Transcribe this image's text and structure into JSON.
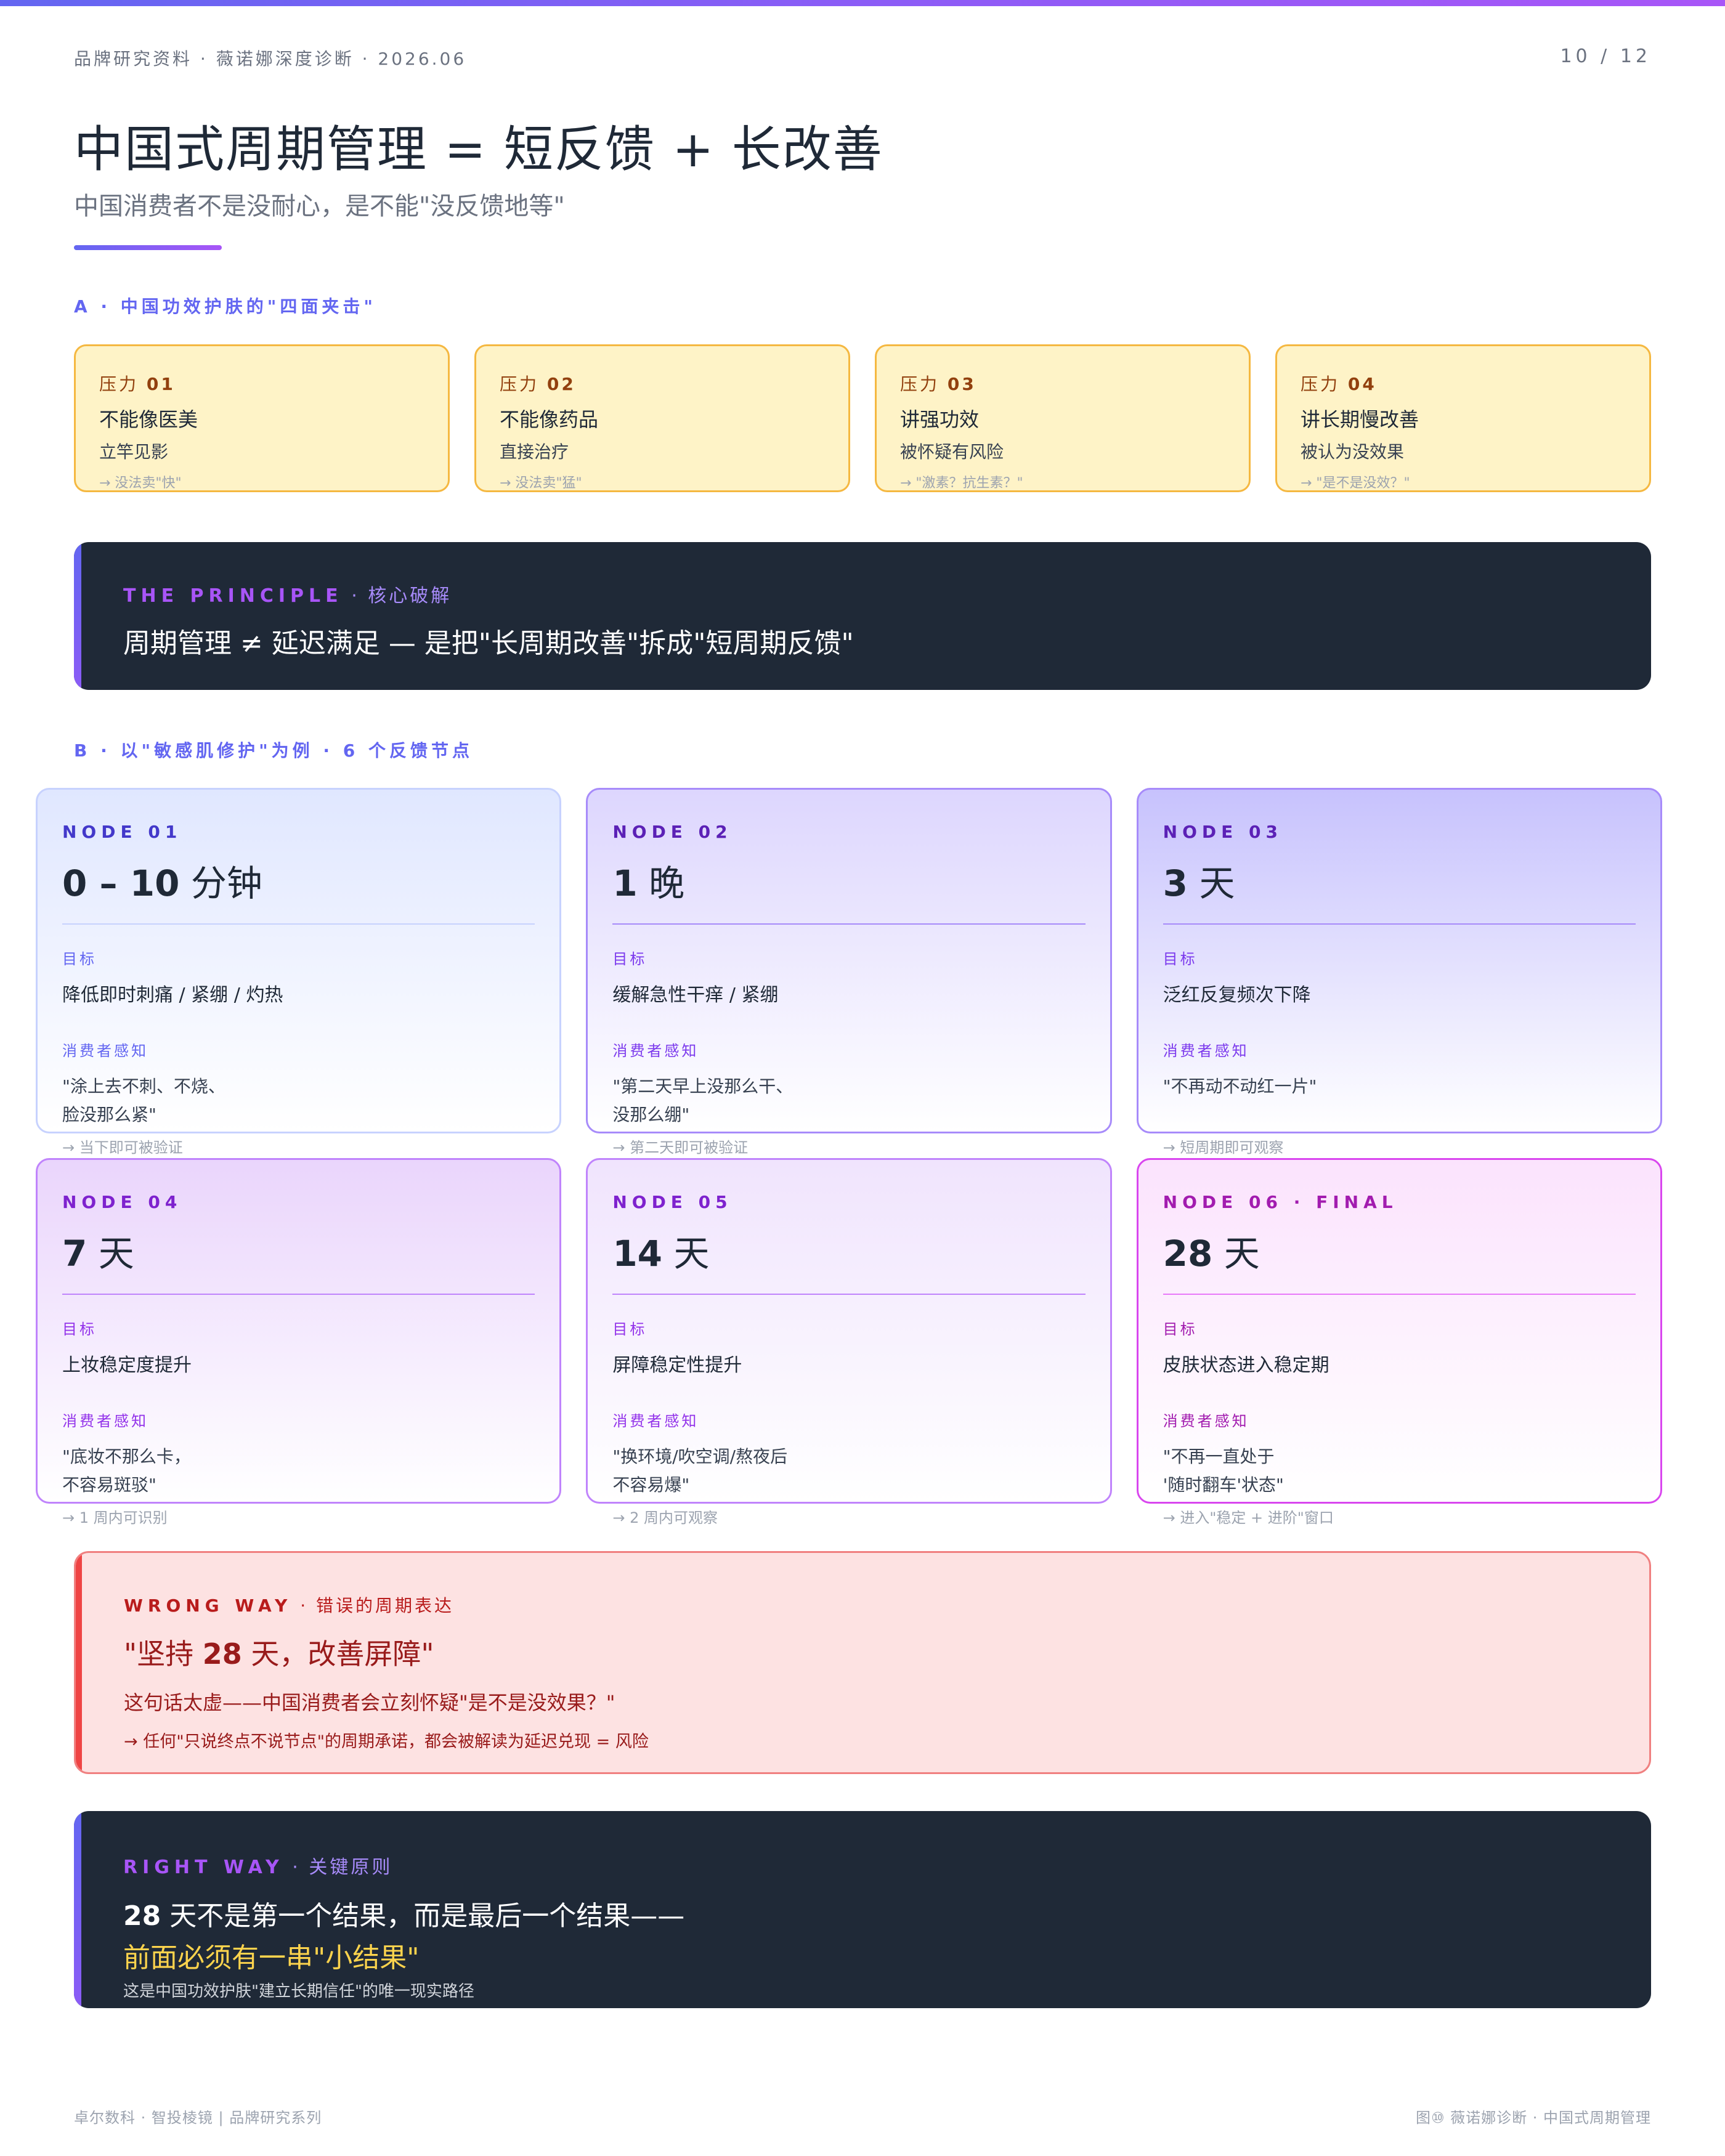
{
  "header": {
    "meta": "品牌研究资料 · 薇诺娜深度诊断 · 2026.06",
    "page_number": "10 / 12",
    "title": "中国式周期管理 = 短反馈 + 长改善",
    "subtitle": "中国消费者不是没耐心，是不能\"没反馈地等\""
  },
  "section_a": {
    "label": "A · 中国功效护肤的\"四面夹击\"",
    "cards": [
      {
        "tag_prefix": "压力",
        "tag_num": "01",
        "main": "不能像医美",
        "sub": "立竿见影",
        "note": "→ 没法卖\"快\""
      },
      {
        "tag_prefix": "压力",
        "tag_num": "02",
        "main": "不能像药品",
        "sub": "直接治疗",
        "note": "→ 没法卖\"猛\""
      },
      {
        "tag_prefix": "压力",
        "tag_num": "03",
        "main": "讲强功效",
        "sub": "被怀疑有风险",
        "note": "→ \"激素？抗生素？\""
      },
      {
        "tag_prefix": "压力",
        "tag_num": "04",
        "main": "讲长期慢改善",
        "sub": "被认为没效果",
        "note": "→ \"是不是没效？\""
      }
    ]
  },
  "principle": {
    "kicker": "THE PRINCIPLE",
    "kicker_cn": " · 核心破解",
    "text": "周期管理 ≠ 延迟满足 — 是把\"长周期改善\"拆成\"短周期反馈\""
  },
  "section_b": {
    "label": "B · 以\"敏感肌修护\"为例 · 6 个反馈节点",
    "goal_label": "目标",
    "perception_label": "消费者感知",
    "nodes": [
      {
        "kicker": "NODE 01",
        "time_num": "0 – 10",
        "time_unit": " 分钟",
        "goal": "降低即时刺痛 / 紧绷 / 灼热",
        "quote_l1": "\"涂上去不刺、不烧、",
        "quote_l2": "脸没那么紧\"",
        "note": "→ 当下即可被验证"
      },
      {
        "kicker": "NODE 02",
        "time_num": "1",
        "time_unit": " 晚",
        "goal": "缓解急性干痒 / 紧绷",
        "quote_l1": "\"第二天早上没那么干、",
        "quote_l2": "没那么绷\"",
        "note": "→ 第二天即可被验证"
      },
      {
        "kicker": "NODE 03",
        "time_num": "3",
        "time_unit": " 天",
        "goal": "泛红反复频次下降",
        "quote_l1": "\"不再动不动红一片\"",
        "quote_l2": "",
        "note": "→ 短周期即可观察"
      },
      {
        "kicker": "NODE 04",
        "time_num": "7",
        "time_unit": " 天",
        "goal": "上妆稳定度提升",
        "quote_l1": "\"底妆不那么卡，",
        "quote_l2": "不容易斑驳\"",
        "note": "→ 1 周内可识别"
      },
      {
        "kicker": "NODE 05",
        "time_num": "14",
        "time_unit": " 天",
        "goal": "屏障稳定性提升",
        "quote_l1": "\"换环境/吹空调/熬夜后",
        "quote_l2": "不容易爆\"",
        "note": "→ 2 周内可观察"
      },
      {
        "kicker": "NODE 06 · FINAL",
        "time_num": "28",
        "time_unit": " 天",
        "goal": "皮肤状态进入稳定期",
        "quote_l1": "\"不再一直处于",
        "quote_l2": "'随时翻车'状态\"",
        "note": "→ 进入\"稳定 + 进阶\"窗口"
      }
    ]
  },
  "wrong_way": {
    "kicker": "WRONG WAY",
    "kicker_cn": " · 错误的周期表达",
    "headline_pre": "\"坚持 ",
    "headline_num": "28",
    "headline_post": " 天，改善屏障\"",
    "body": "这句话太虚——中国消费者会立刻怀疑\"是不是没效果？\"",
    "note": "→ 任何\"只说终点不说节点\"的周期承诺，都会被解读为延迟兑现 = 风险"
  },
  "right_way": {
    "kicker": "RIGHT WAY",
    "kicker_cn": " · 关键原则",
    "line1_num": "28",
    "line1_rest": " 天不是第一个结果，而是最后一个结果——",
    "line2": "前面必须有一串\"小结果\"",
    "line3": "这是中国功效护肤\"建立长期信任\"的唯一现实路径"
  },
  "footer": {
    "left": "卓尔数科 · 智投棱镜  |  品牌研究系列",
    "right": "图⑩ 薇诺娜诊断 · 中国式周期管理"
  },
  "colors": {
    "accent": "#6366f1",
    "purple": "#a855f7",
    "dark": "#1f2937",
    "pressure_bg": "#fef3c7",
    "pressure_border": "#f5b841",
    "wrong_bg": "#fde2e2",
    "wrong_text": "#991b1b",
    "highlight_yellow": "#fcd34d"
  }
}
